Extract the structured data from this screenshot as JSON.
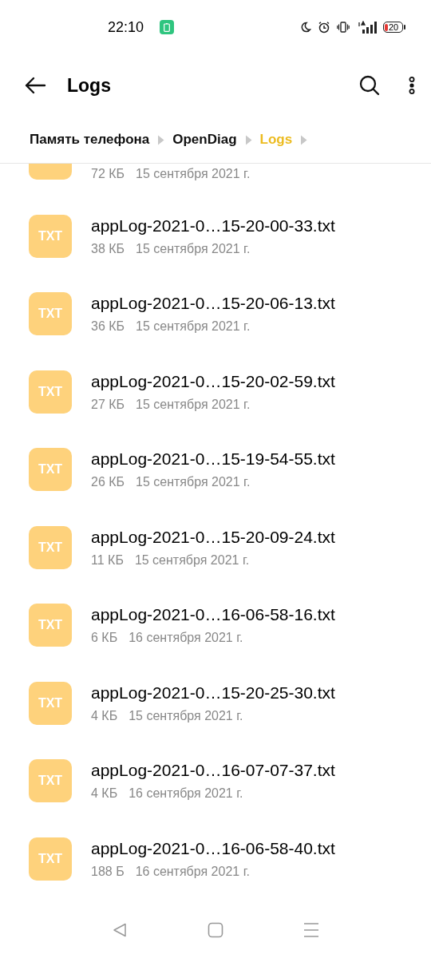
{
  "status_bar": {
    "time": "22:10",
    "battery": "20"
  },
  "toolbar": {
    "title": "Logs"
  },
  "breadcrumbs": [
    {
      "label": "Память телефона",
      "selected": false
    },
    {
      "label": "OpenDiag",
      "selected": false
    },
    {
      "label": "Logs",
      "selected": true
    }
  ],
  "clipped_item": {
    "size": "72 КБ",
    "date": "15 сентября 2021 г."
  },
  "files": [
    {
      "type": "TXT",
      "name": "appLog-2021-0…15-20-00-33.txt",
      "size": "38 КБ",
      "date": "15 сентября 2021 г."
    },
    {
      "type": "TXT",
      "name": "appLog-2021-0…15-20-06-13.txt",
      "size": "36 КБ",
      "date": "15 сентября 2021 г."
    },
    {
      "type": "TXT",
      "name": "appLog-2021-0…15-20-02-59.txt",
      "size": "27 КБ",
      "date": "15 сентября 2021 г."
    },
    {
      "type": "TXT",
      "name": "appLog-2021-0…15-19-54-55.txt",
      "size": "26 КБ",
      "date": "15 сентября 2021 г."
    },
    {
      "type": "TXT",
      "name": "appLog-2021-0…15-20-09-24.txt",
      "size": "11 КБ",
      "date": "15 сентября 2021 г."
    },
    {
      "type": "TXT",
      "name": "appLog-2021-0…16-06-58-16.txt",
      "size": "6 КБ",
      "date": "16 сентября 2021 г."
    },
    {
      "type": "TXT",
      "name": "appLog-2021-0…15-20-25-30.txt",
      "size": "4 КБ",
      "date": "15 сентября 2021 г."
    },
    {
      "type": "TXT",
      "name": "appLog-2021-0…16-07-07-37.txt",
      "size": "4 КБ",
      "date": "16 сентября 2021 г."
    },
    {
      "type": "TXT",
      "name": "appLog-2021-0…16-06-58-40.txt",
      "size": "188 Б",
      "date": "16 сентября 2021 г."
    }
  ]
}
